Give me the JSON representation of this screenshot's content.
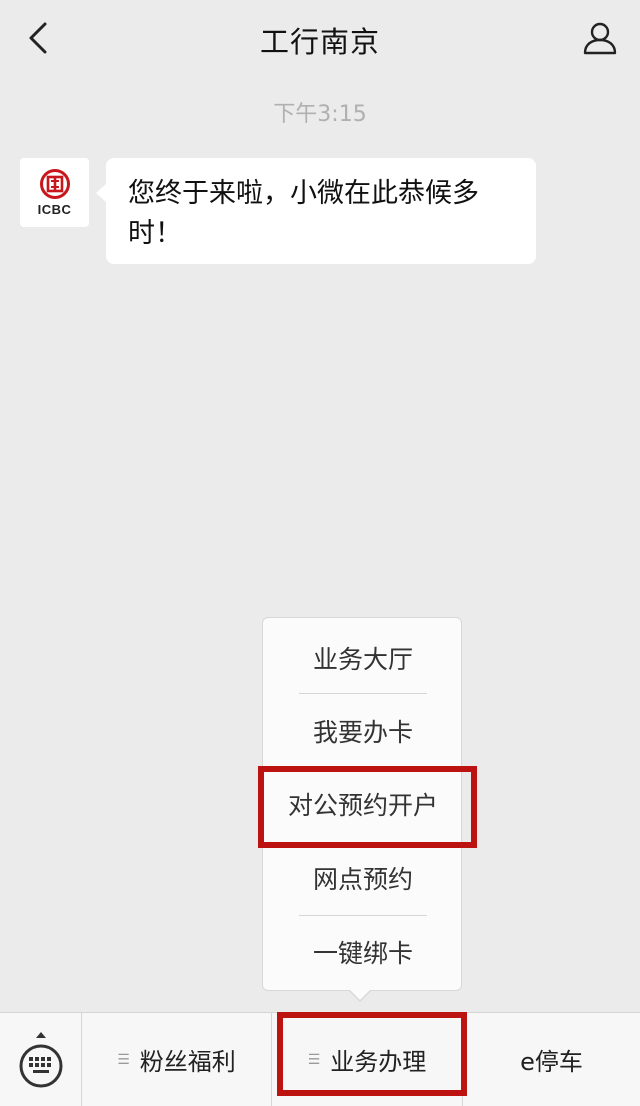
{
  "header": {
    "title": "工行南京",
    "back_icon": "chevron-left-icon",
    "user_icon": "person-icon"
  },
  "chat": {
    "timestamp": "下午3:15",
    "avatar": {
      "logo_text": "ICBC",
      "brand_color": "#c8161d"
    },
    "message": "您终于来啦，小微在此恭候多时！"
  },
  "popup_menu": {
    "items": [
      {
        "label": "业务大厅"
      },
      {
        "label": "我要办卡"
      },
      {
        "label": "对公预约开户",
        "highlighted": true
      },
      {
        "label": "网点预约"
      },
      {
        "label": "一键绑卡"
      }
    ]
  },
  "bottom_menu": {
    "keyboard_icon": "keyboard-icon",
    "tabs": [
      {
        "label": "粉丝福利",
        "has_submenu": true
      },
      {
        "label": "业务办理",
        "has_submenu": true,
        "highlighted": true
      },
      {
        "label": "e停车",
        "has_submenu": false
      }
    ]
  },
  "colors": {
    "background": "#ebebeb",
    "highlight": "#bd1310",
    "bubble": "#ffffff"
  }
}
